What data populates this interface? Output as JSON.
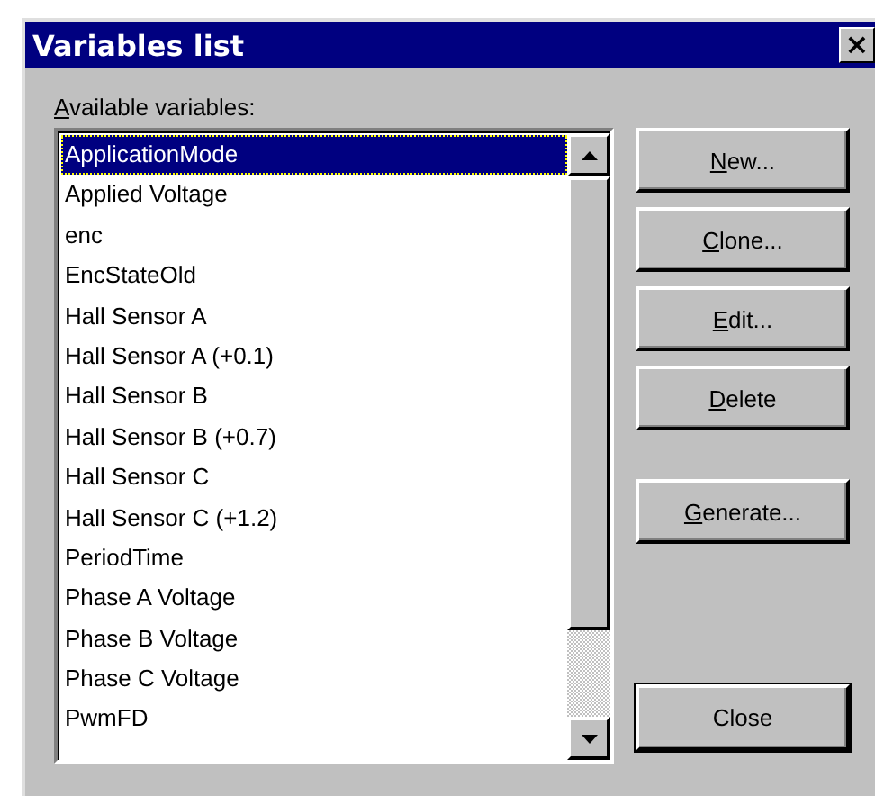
{
  "window": {
    "title": "Variables list",
    "close": "×"
  },
  "label": {
    "key": "A",
    "rest": "vailable variables:"
  },
  "variables": [
    {
      "name": "ApplicationMode",
      "selected": true
    },
    {
      "name": "Applied Voltage",
      "selected": false
    },
    {
      "name": "enc",
      "selected": false
    },
    {
      "name": "EncStateOld",
      "selected": false
    },
    {
      "name": "Hall Sensor A",
      "selected": false
    },
    {
      "name": "Hall Sensor A (+0.1)",
      "selected": false
    },
    {
      "name": "Hall Sensor B",
      "selected": false
    },
    {
      "name": "Hall Sensor B (+0.7)",
      "selected": false
    },
    {
      "name": "Hall Sensor C",
      "selected": false
    },
    {
      "name": "Hall Sensor C (+1.2)",
      "selected": false
    },
    {
      "name": "PeriodTime",
      "selected": false
    },
    {
      "name": "Phase A Voltage",
      "selected": false
    },
    {
      "name": "Phase B Voltage",
      "selected": false
    },
    {
      "name": "Phase C Voltage",
      "selected": false
    },
    {
      "name": "PwmFD",
      "selected": false
    }
  ],
  "buttons": [
    {
      "key": "N",
      "rest": "ew...",
      "default": false
    },
    {
      "key": "C",
      "rest": "lone...",
      "default": false
    },
    {
      "key": "E",
      "rest": "dit...",
      "default": false
    },
    {
      "key": "D",
      "rest": "elete",
      "default": false
    },
    {
      "key": "G",
      "rest": "enerate...",
      "default": false
    },
    {
      "rest": "Close",
      "default": true
    }
  ]
}
